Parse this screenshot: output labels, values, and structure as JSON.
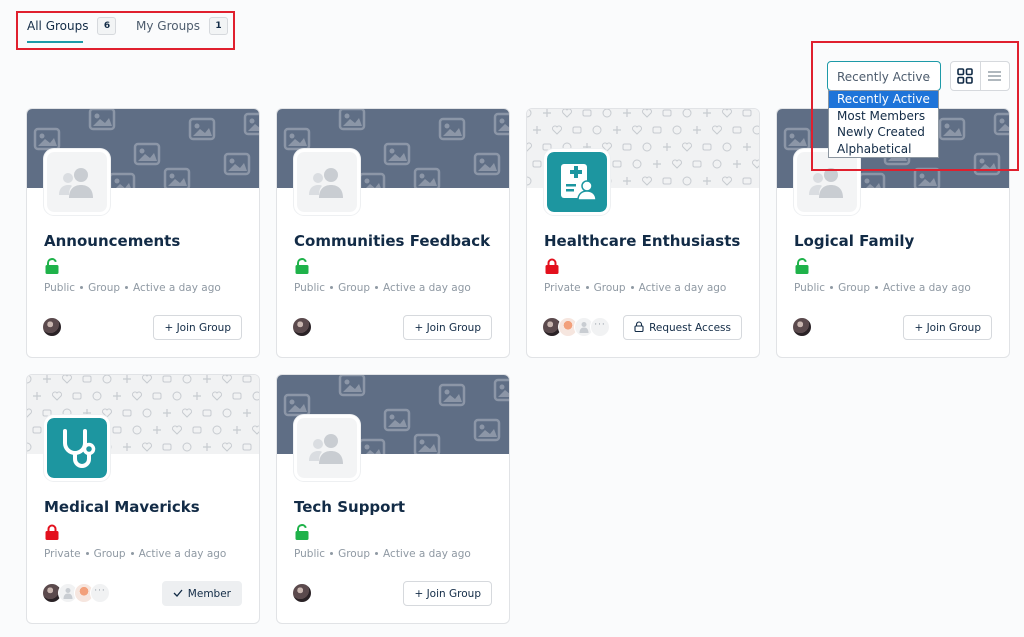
{
  "tabs": [
    {
      "label": "All Groups",
      "count": "6"
    },
    {
      "label": "My Groups",
      "count": "1"
    }
  ],
  "sort": {
    "selected": "Recently Active",
    "options": [
      "Recently Active",
      "Most Members",
      "Newly Created",
      "Alphabetical"
    ]
  },
  "view_icons": [
    "grid-view-icon",
    "list-view-icon"
  ],
  "colors": {
    "accent": "#1d9aa8",
    "public_lock": "#1fb24a",
    "private_lock": "#e3101d",
    "cover": "#5f6e85",
    "highlight_box": "#e0202e"
  },
  "groups": [
    {
      "title": "Announcements",
      "visibility": "Public",
      "type": "Group",
      "activity": "Active a day ago",
      "action": "+ Join Group",
      "avatar_icon": "group-placeholder-icon",
      "lock_icon": "unlocked-icon"
    },
    {
      "title": "Communities Feedback",
      "visibility": "Public",
      "type": "Group",
      "activity": "Active a day ago",
      "action": "+ Join Group",
      "avatar_icon": "group-placeholder-icon",
      "lock_icon": "unlocked-icon"
    },
    {
      "title": "Healthcare Enthusiasts",
      "visibility": "Private",
      "type": "Group",
      "activity": "Active a day ago",
      "action": "Request Access",
      "avatar_icon": "medical-record-icon",
      "lock_icon": "locked-icon"
    },
    {
      "title": "Logical Family",
      "visibility": "Public",
      "type": "Group",
      "activity": "Active a day ago",
      "action": "+ Join Group",
      "avatar_icon": "group-placeholder-icon",
      "lock_icon": "unlocked-icon"
    },
    {
      "title": "Medical Mavericks",
      "visibility": "Private",
      "type": "Group",
      "activity": "Active a day ago",
      "action": "Member",
      "avatar_icon": "stethoscope-icon",
      "lock_icon": "locked-icon"
    },
    {
      "title": "Tech Support",
      "visibility": "Public",
      "type": "Group",
      "activity": "Active a day ago",
      "action": "+ Join Group",
      "avatar_icon": "group-placeholder-icon",
      "lock_icon": "unlocked-icon"
    }
  ]
}
